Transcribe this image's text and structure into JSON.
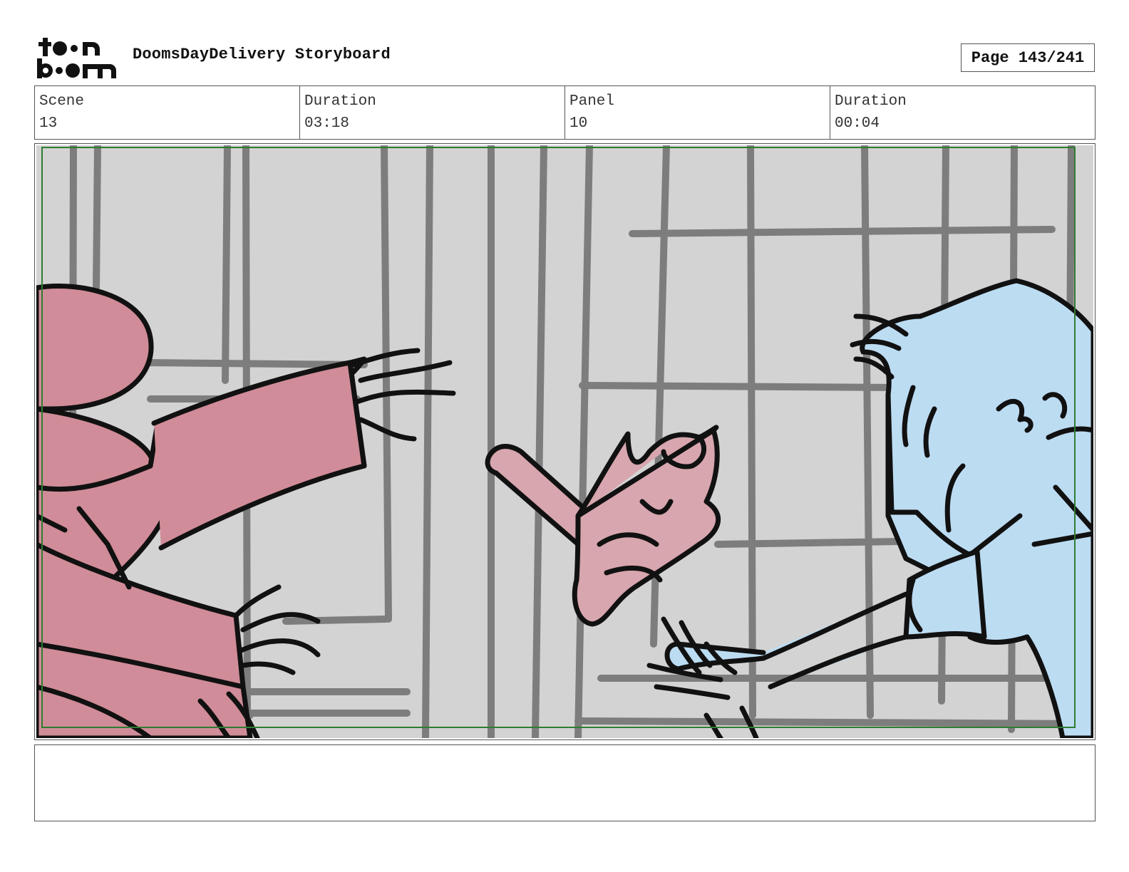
{
  "header": {
    "logo_text": "toon boom",
    "title": "DoomsDayDelivery Storyboard",
    "page_label": "Page 143/241"
  },
  "info": {
    "scene_label": "Scene",
    "scene_value": "13",
    "scene_duration_label": "Duration",
    "scene_duration_value": "03:18",
    "panel_label": "Panel",
    "panel_value": "10",
    "panel_duration_label": "Duration",
    "panel_duration_value": "00:04"
  },
  "panel": {
    "background_color": "#d3d3d3",
    "left_character_color": "#d08c98",
    "right_character_color": "#bcdcf2",
    "object_color": "#d8a6ae",
    "safe_frame_color": "#2e7d32"
  },
  "notes": {
    "text": ""
  }
}
